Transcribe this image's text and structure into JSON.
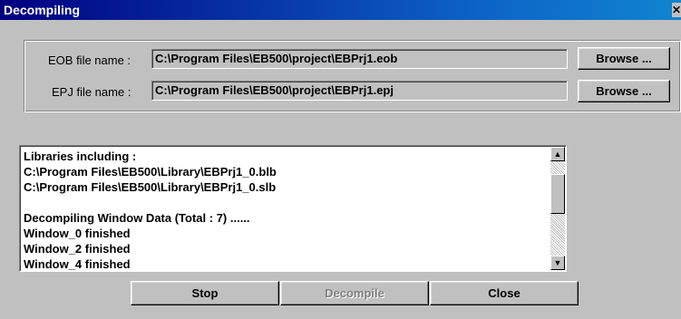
{
  "window": {
    "title": "Decompiling",
    "close_glyph": "✕"
  },
  "eob": {
    "label": "EOB file name :",
    "value": "C:\\Program Files\\EB500\\project\\EBPrj1.eob",
    "browse_label": "Browse ..."
  },
  "epj": {
    "label": "EPJ file name :",
    "value": "C:\\Program Files\\EB500\\project\\EBPrj1.epj",
    "browse_label": "Browse ..."
  },
  "log": {
    "lines": [
      "Libraries including :",
      "C:\\Program Files\\EB500\\Library\\EBPrj1_0.blb",
      "C:\\Program Files\\EB500\\Library\\EBPrj1_0.slb",
      "",
      "Decompiling Window Data (Total : 7) ......",
      "Window_0  finished",
      "Window_2  finished",
      "Window_4  finished"
    ],
    "scroll_up_glyph": "▲",
    "scroll_down_glyph": "▼"
  },
  "buttons": {
    "stop": "Stop",
    "decompile": "Decompile",
    "close": "Close"
  }
}
